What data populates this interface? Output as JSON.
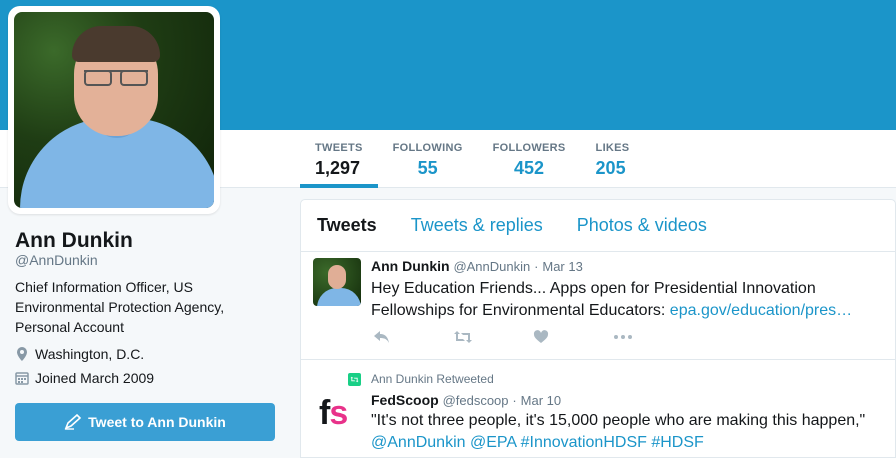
{
  "profile": {
    "name": "Ann Dunkin",
    "handle": "@AnnDunkin",
    "bio": "Chief Information Officer, US Environmental Protection Agency, Personal Account",
    "location": "Washington, D.C.",
    "joined": "Joined March 2009",
    "tweet_to_label": "Tweet to Ann Dunkin"
  },
  "stats": [
    {
      "label": "TWEETS",
      "value": "1,297"
    },
    {
      "label": "FOLLOWING",
      "value": "55"
    },
    {
      "label": "FOLLOWERS",
      "value": "452"
    },
    {
      "label": "LIKES",
      "value": "205"
    }
  ],
  "tabs": [
    "Tweets",
    "Tweets & replies",
    "Photos & videos"
  ],
  "tweets": [
    {
      "name": "Ann Dunkin",
      "handle": "@AnnDunkin",
      "date": "Mar 13",
      "text": "Hey Education Friends... Apps open for Presidential Innovation Fellowships for Environmental Educators: ",
      "link": "epa.gov/education/pres…"
    },
    {
      "retweeted_by": "Ann Dunkin Retweeted",
      "name": "FedScoop",
      "handle": "@fedscoop",
      "date": "Mar 10",
      "text": "\"It's not three people, it's 15,000 people who are making this happen,\"",
      "mentions": "@AnnDunkin @EPA #InnovationHDSF #HDSF",
      "logo_f": "f",
      "logo_s": "s"
    }
  ],
  "colors": {
    "accent": "#1b95c9",
    "banner": "#1b95c9",
    "retweet": "#19cf86",
    "fedscoop_pink": "#e8328a"
  }
}
